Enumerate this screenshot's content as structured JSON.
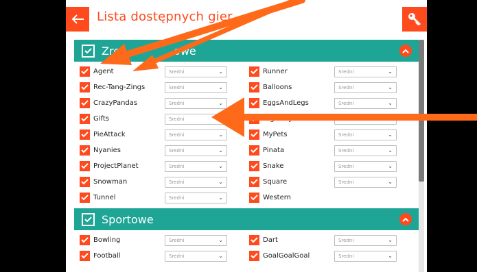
{
  "header": {
    "title": "Lista dostępnych gier",
    "back_icon": "arrow-left-icon",
    "key_icon": "key-icon"
  },
  "colors": {
    "accent": "#ff4a1d",
    "section": "#1ea596"
  },
  "sections": [
    {
      "label": "Zręcznościowe",
      "visible_label_left": "Zre",
      "visible_label_right": "owe",
      "rows": [
        {
          "left": {
            "name": "Agent",
            "level": "Sredni"
          },
          "right": {
            "name": "Runner",
            "level": "Sredni"
          }
        },
        {
          "left": {
            "name": "Rec-Tang-Zings",
            "level": "Sredni"
          },
          "right": {
            "name": "Balloons",
            "level": "Sredni"
          }
        },
        {
          "left": {
            "name": "CrazyPandas",
            "level": "Sredni"
          },
          "right": {
            "name": "EggsAndLegs",
            "level": "Sredni"
          }
        },
        {
          "left": {
            "name": "Gifts",
            "level": "Sredni"
          },
          "right": {
            "name": "Highway",
            "level": "Sredni"
          }
        },
        {
          "left": {
            "name": "PieAttack",
            "level": "Sredni"
          },
          "right": {
            "name": "MyPets",
            "level": "Sredni"
          }
        },
        {
          "left": {
            "name": "Nyanies",
            "level": "Sredni"
          },
          "right": {
            "name": "Pinata",
            "level": "Sredni"
          }
        },
        {
          "left": {
            "name": "ProjectPlanet",
            "level": "Sredni"
          },
          "right": {
            "name": "Snake",
            "level": "Sredni"
          }
        },
        {
          "left": {
            "name": "Snowman",
            "level": "Sredni"
          },
          "right": {
            "name": "Square",
            "level": "Sredni"
          }
        },
        {
          "left": {
            "name": "Tunnel",
            "level": "Sredni"
          },
          "right": {
            "name": "Western",
            "level": ""
          }
        }
      ]
    },
    {
      "label": "Sportowe",
      "rows": [
        {
          "left": {
            "name": "Bowling",
            "level": "Sredni"
          },
          "right": {
            "name": "Dart",
            "level": "Sredni"
          }
        },
        {
          "left": {
            "name": "Football",
            "level": "Sredni"
          },
          "right": {
            "name": "GoalGoalGoal",
            "level": "Sredni"
          }
        }
      ]
    }
  ]
}
